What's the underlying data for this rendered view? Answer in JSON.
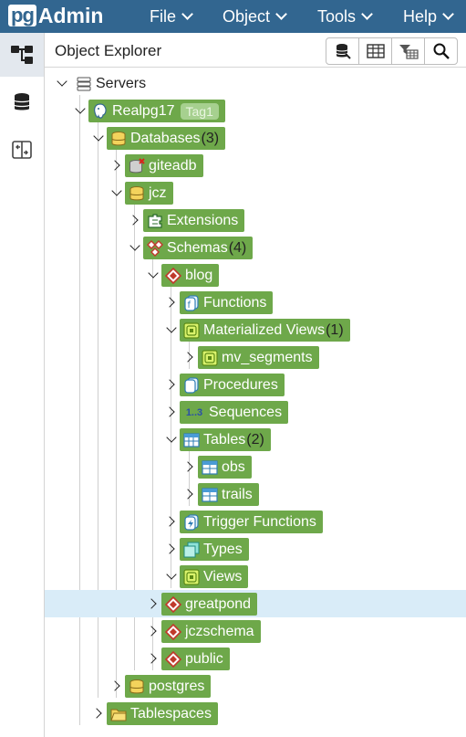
{
  "app": {
    "logo_pg": "pg",
    "logo_admin": "Admin"
  },
  "menu": [
    {
      "label": "File"
    },
    {
      "label": "Object"
    },
    {
      "label": "Tools"
    },
    {
      "label": "Help"
    }
  ],
  "sidebar": {
    "items": [
      {
        "icon": "tree-icon"
      },
      {
        "icon": "database-icon"
      },
      {
        "icon": "swap-icon"
      }
    ]
  },
  "panel": {
    "title": "Object Explorer"
  },
  "toolbar": {
    "buttons": [
      "query-tool-icon",
      "table-view-icon",
      "filter-rows-icon",
      "search-icon"
    ]
  },
  "colors": {
    "topbar": "#326690",
    "node_bg": "#6ea84a",
    "selected_row": "#d9ecf8"
  },
  "tree": {
    "servers": {
      "label": "Servers"
    },
    "realpg17": {
      "label": "Realpg17",
      "badge": "Tag1"
    },
    "databases": {
      "label": "Databases",
      "count": "(3)"
    },
    "giteadb": {
      "label": "giteadb"
    },
    "jcz": {
      "label": "jcz"
    },
    "extensions": {
      "label": "Extensions"
    },
    "schemas": {
      "label": "Schemas",
      "count": "(4)"
    },
    "blog": {
      "label": "blog"
    },
    "functions": {
      "label": "Functions"
    },
    "matviews": {
      "label": "Materialized Views",
      "count": "(1)"
    },
    "mv_segments": {
      "label": "mv_segments"
    },
    "procedures": {
      "label": "Procedures"
    },
    "sequences": {
      "label": "Sequences",
      "icon_text": "1..3"
    },
    "tables": {
      "label": "Tables",
      "count": "(2)"
    },
    "obs": {
      "label": "obs"
    },
    "trails": {
      "label": "trails"
    },
    "trigger_functions": {
      "label": "Trigger Functions"
    },
    "types": {
      "label": "Types"
    },
    "views": {
      "label": "Views"
    },
    "greatpond": {
      "label": "greatpond"
    },
    "jczschema": {
      "label": "jczschema"
    },
    "public": {
      "label": "public"
    },
    "postgres": {
      "label": "postgres"
    },
    "tablespaces": {
      "label": "Tablespaces"
    }
  }
}
